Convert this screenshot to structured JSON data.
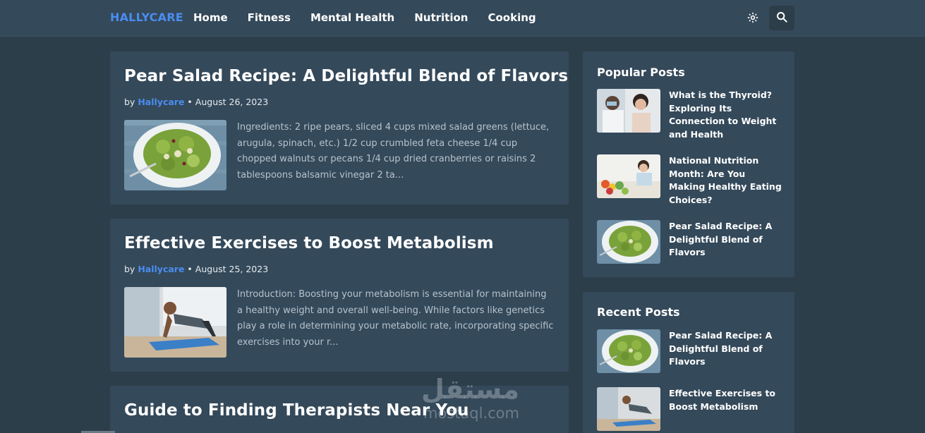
{
  "nav": {
    "brand": "HALLYCARE",
    "links": [
      "Home",
      "Fitness",
      "Mental Health",
      "Nutrition",
      "Cooking"
    ],
    "icons": [
      "gear-icon",
      "search-icon"
    ]
  },
  "posts": [
    {
      "title": "Pear Salad Recipe: A Delightful Blend of Flavors",
      "by": "by",
      "author": "Hallycare",
      "date": "August 26, 2023",
      "excerpt": "Ingredients: 2 ripe pears, sliced 4 cups mixed salad greens (lettuce, arugula, spinach, etc.) 1/2 cup crumbled feta cheese 1/4 cup chopped walnuts or pecans 1/4 cup dried cranberries or raisins 2 tablespoons balsamic vinegar 2 ta..."
    },
    {
      "title": "Effective Exercises to Boost Metabolism",
      "by": "by",
      "author": "Hallycare",
      "date": "August 25, 2023",
      "excerpt": "Introduction: Boosting your metabolism is essential for maintaining a healthy weight and overall well-being. While factors like genetics play a role in determining your metabolic rate, incorporating specific exercises into your r..."
    },
    {
      "title": "Guide to Finding Therapists Near You"
    }
  ],
  "popular": {
    "title": "Popular Posts",
    "items": [
      "What is the Thyroid? Exploring Its Connection to Weight and Health",
      "National Nutrition Month: Are You Making Healthy Eating Choices?",
      "Pear Salad Recipe: A Delightful Blend of Flavors"
    ]
  },
  "recent": {
    "title": "Recent Posts",
    "items": [
      "Pear Salad Recipe: A Delightful Blend of Flavors",
      "Effective Exercises to Boost Metabolism"
    ]
  },
  "watermark": {
    "arabic": "مستقل",
    "latin": "mostaql.com"
  },
  "colors": {
    "background": "#2c3e4a",
    "card": "#34495a",
    "accent": "#4a8df0"
  }
}
